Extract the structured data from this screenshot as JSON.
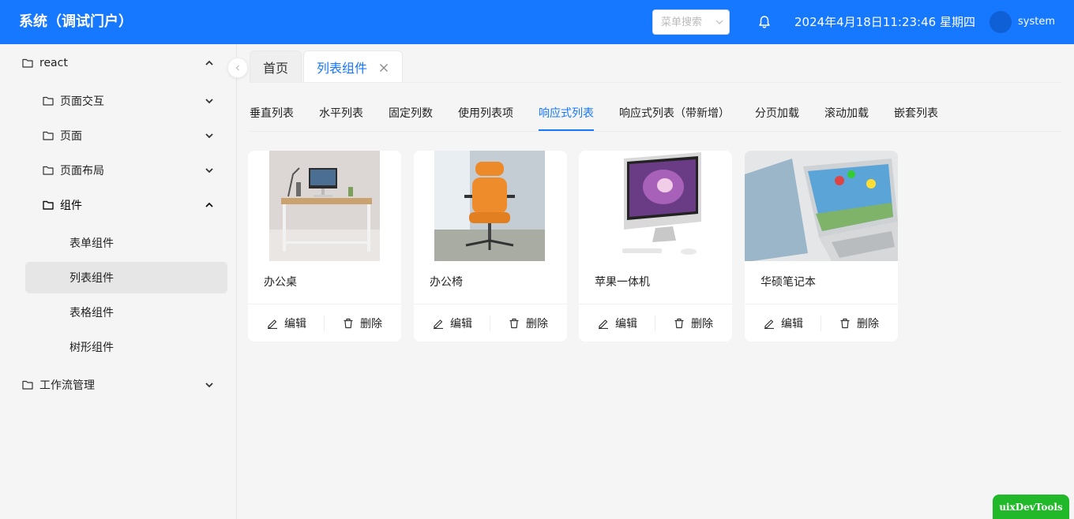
{
  "header": {
    "brand": "系统（调试门户）",
    "menu_search_placeholder": "菜单搜索",
    "datetime": "2024年4月18日11:23:46 星期四",
    "username": "system"
  },
  "sidebar": {
    "items": [
      {
        "label": "react"
      },
      {
        "label": "页面交互"
      },
      {
        "label": "页面"
      },
      {
        "label": "页面布局"
      },
      {
        "label": "组件"
      },
      {
        "label": "表单组件"
      },
      {
        "label": "列表组件"
      },
      {
        "label": "表格组件"
      },
      {
        "label": "树形组件"
      },
      {
        "label": "工作流管理"
      }
    ]
  },
  "page_tabs": [
    {
      "label": "首页"
    },
    {
      "label": "列表组件"
    }
  ],
  "sub_tabs": [
    {
      "label": "垂直列表"
    },
    {
      "label": "水平列表"
    },
    {
      "label": "固定列数"
    },
    {
      "label": "使用列表项"
    },
    {
      "label": "响应式列表"
    },
    {
      "label": "响应式列表（带新增）"
    },
    {
      "label": "分页加载"
    },
    {
      "label": "滚动加载"
    },
    {
      "label": "嵌套列表"
    }
  ],
  "cards": [
    {
      "title": "办公桌",
      "edit": "编辑",
      "delete": "删除"
    },
    {
      "title": "办公椅",
      "edit": "编辑",
      "delete": "删除"
    },
    {
      "title": "苹果一体机",
      "edit": "编辑",
      "delete": "删除"
    },
    {
      "title": "华硕笔记本",
      "edit": "编辑",
      "delete": "删除"
    }
  ],
  "devtools_label": "uixDevTools",
  "colors": {
    "primary": "#1677ff",
    "devtools": "#21b82a"
  }
}
